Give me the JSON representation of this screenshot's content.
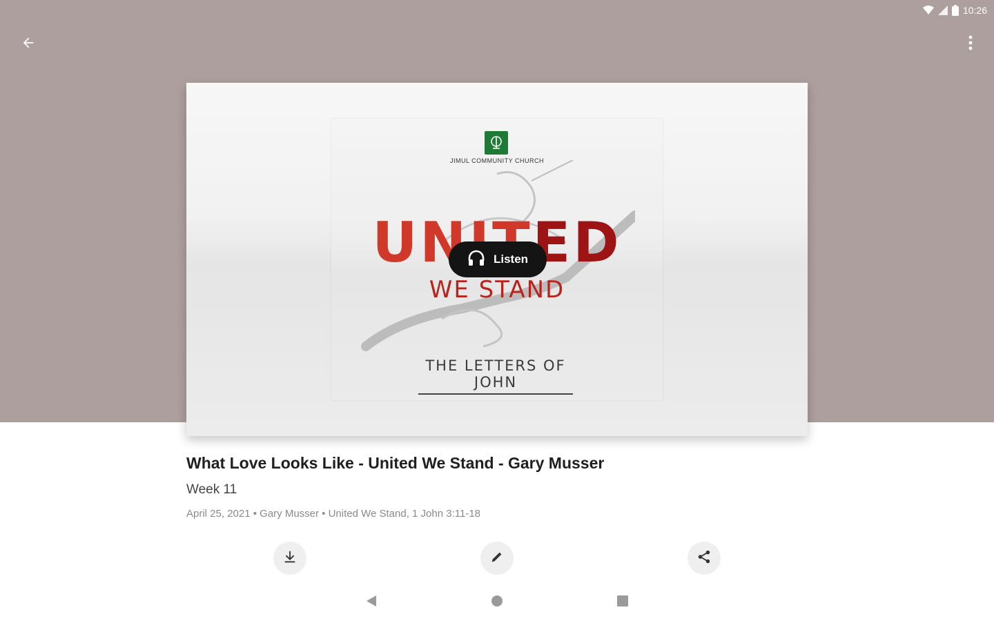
{
  "status_bar": {
    "time": "10:26",
    "icons": [
      "wifi-icon",
      "signal-icon",
      "battery-icon"
    ]
  },
  "toolbar": {
    "back_icon": "arrow-left-icon",
    "more_icon": "more-vertical-icon"
  },
  "artwork": {
    "church_name": "JIMUL COMMUNITY CHURCH",
    "title_light": "UN",
    "title_mid": "IT",
    "title_dark": "ED",
    "subtitle": "WE STAND",
    "series": "THE LETTERS OF JOHN",
    "listen_label": "Listen",
    "colors": {
      "title_red": "#d0392a",
      "title_dark_red": "#9e1414",
      "logo_green": "#1e7a34"
    }
  },
  "sermon": {
    "title": "What Love Looks Like - United We Stand - Gary Musser",
    "subtitle": "Week 11",
    "meta": "April 25, 2021 • Gary Musser • United We Stand, 1 John 3:11-18"
  },
  "actions": [
    "download-icon",
    "edit-icon",
    "share-icon"
  ],
  "colors": {
    "hero_background": "#ad9f9d",
    "page_background": "#ffffff"
  }
}
